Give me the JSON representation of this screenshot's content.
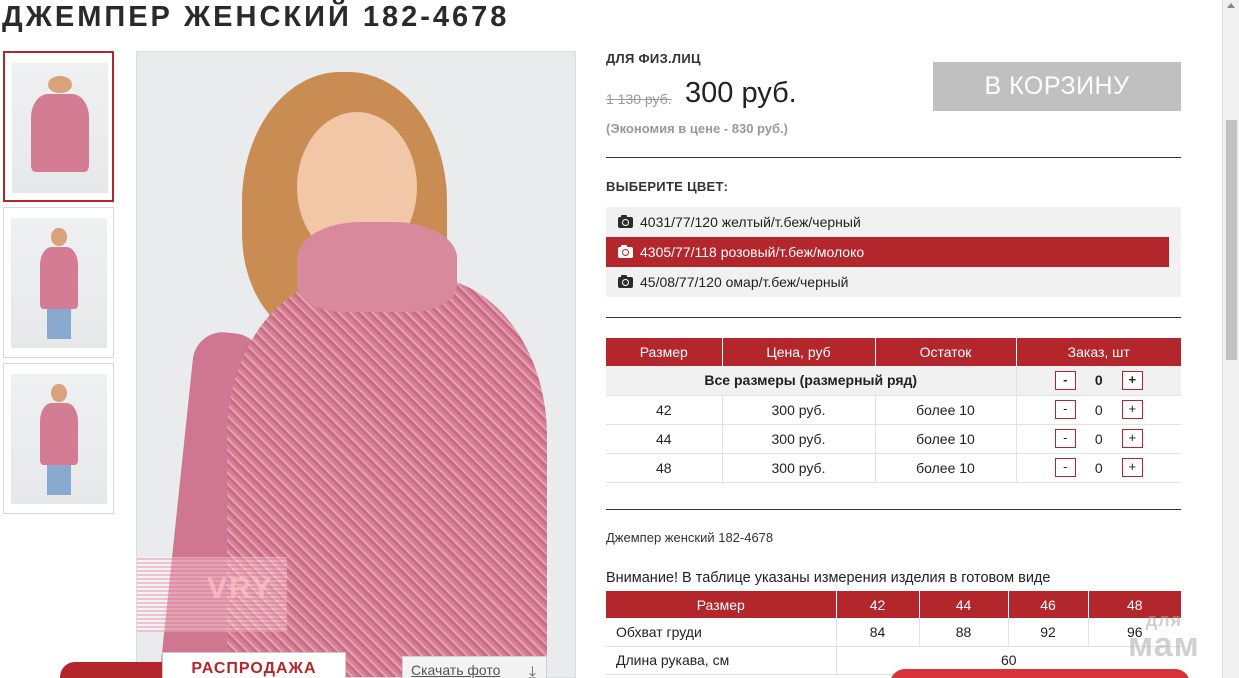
{
  "product": {
    "title": "ДЖЕМПЕР ЖЕНСКИЙ 182-4678",
    "description": "Джемпер женский 182-4678"
  },
  "gallery": {
    "thumbnails": [
      {
        "label": "thumbnail-1",
        "active": true
      },
      {
        "label": "thumbnail-2",
        "active": false
      },
      {
        "label": "thumbnail-3",
        "active": false
      }
    ],
    "watermark_text": "VRY",
    "sale_badge": "РАСПРОДАЖА",
    "download_label": "Скачать фото"
  },
  "pricing": {
    "customer_type": "ДЛЯ ФИЗ.ЛИЦ",
    "old_price": "1 130 руб.",
    "new_price": "300 руб.",
    "economy": "(Экономия в цене - 830 руб.)",
    "cart_button": "В КОРЗИНУ"
  },
  "colors": {
    "heading": "ВЫБЕРИТЕ ЦВЕТ:",
    "items": [
      {
        "label": "4031/77/120 желтый/т.беж/черный",
        "selected": false
      },
      {
        "label": "4305/77/118 розовый/т.беж/молоко",
        "selected": true
      },
      {
        "label": "45/08/77/120 омар/т.беж/черный",
        "selected": false
      }
    ]
  },
  "size_table": {
    "headers": [
      "Размер",
      "Цена, руб",
      "Остаток",
      "Заказ, шт"
    ],
    "all_sizes_label": "Все размеры (размерный ряд)",
    "all_sizes_qty": "0",
    "minus": "-",
    "plus": "+",
    "rows": [
      {
        "size": "42",
        "price": "300 руб.",
        "stock": "более 10",
        "qty": "0"
      },
      {
        "size": "44",
        "price": "300 руб.",
        "stock": "более 10",
        "qty": "0"
      },
      {
        "size": "48",
        "price": "300 руб.",
        "stock": "более 10",
        "qty": "0"
      }
    ]
  },
  "measurements": {
    "warning": "Внимание! В таблице указаны измерения изделия в готовом виде",
    "headers": [
      "Размер",
      "42",
      "44",
      "46",
      "48"
    ],
    "rows": [
      {
        "label": "Обхват груди",
        "values": [
          "84",
          "88",
          "92",
          "96"
        ]
      },
      {
        "label": "Длина рукава, см",
        "value": "60"
      }
    ]
  },
  "site_logo": {
    "line1": "для",
    "line2": "мам"
  },
  "colors_theme": {
    "accent": "#b2262c",
    "cart_button": "#c0c0c0"
  }
}
